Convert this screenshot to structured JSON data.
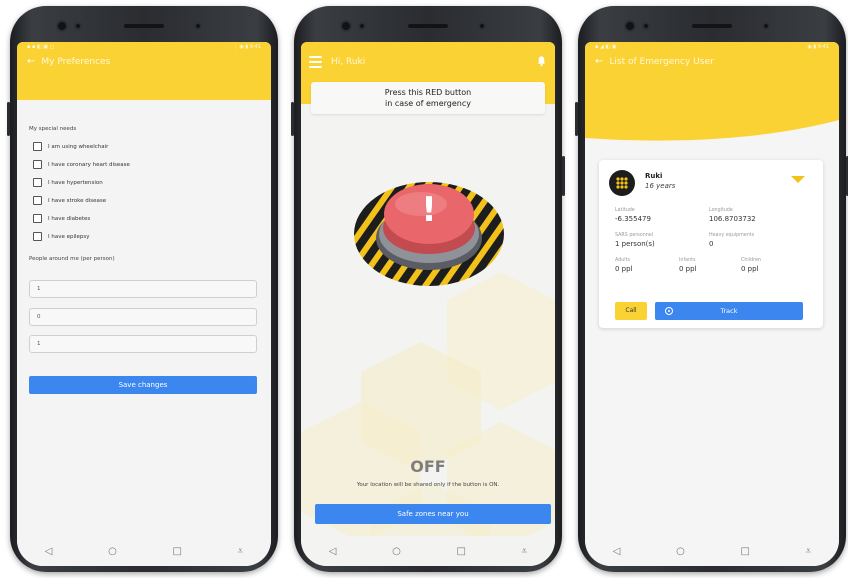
{
  "screen1": {
    "status_left": "▪ ▪ ◧ ▣ ◻",
    "status_right": "⋮ ◉ ▮ 9:41",
    "title": "My Preferences",
    "section_needs": "My special needs",
    "checkboxes": [
      "I am using wheelchair",
      "I have coronary heart disease",
      "I have hypertension",
      "I have stroke disease",
      "I have diabetes",
      "I have epilepsy"
    ],
    "section_people": "People around me (per person)",
    "inputs": [
      "1",
      "0",
      "1"
    ],
    "save_label": "Save changes"
  },
  "screen2": {
    "title": "Hi, Ruki",
    "notice_line1": "Press this RED button",
    "notice_line2": "in case of emergency",
    "button_mark": "!",
    "state": "OFF",
    "location_note": "Your location will be shared only if the button is ON.",
    "safe_zones_label": "Safe zones near you"
  },
  "screen3": {
    "status_left": "▪ ◢ ◧ ▣",
    "status_right": "◉ ▮ 9:41",
    "title": "List of Emergency User",
    "user_name": "Ruki",
    "user_age": "16 years",
    "latitude_label": "Latitude",
    "latitude": "-6.355479",
    "longitude_label": "Longitude",
    "longitude": "106.8703732",
    "sars_label": "SARS personnel",
    "sars_value": "1 person(s)",
    "heavy_label": "Heavy equipments",
    "heavy_value": "0",
    "adults_label": "Adults",
    "adults_value": "0 ppl",
    "infants_label": "Infants",
    "infants_value": "0 ppl",
    "children_label": "Children",
    "children_value": "0 ppl",
    "call_label": "Call",
    "track_label": "Track"
  },
  "navbar": {
    "back": "◁",
    "home": "○",
    "recents": "□",
    "extra": "⩡"
  },
  "colors": {
    "yellow": "#fbd234",
    "blue": "#3c86f0",
    "red": "#e9666a"
  }
}
